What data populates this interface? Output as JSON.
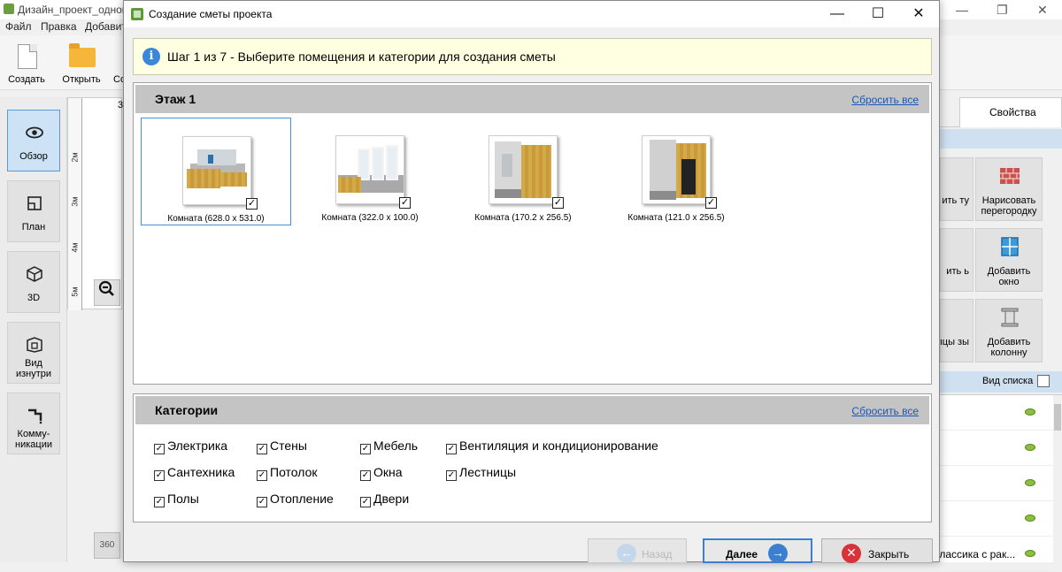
{
  "background_app": {
    "title": "Дизайн_проект_однок",
    "window_controls": [
      "—",
      "❐",
      "✕"
    ],
    "menu": [
      "Файл",
      "Правка",
      "Добавит"
    ],
    "toolbar": [
      {
        "label": "Создать",
        "icon": "new-document-icon"
      },
      {
        "label": "Открыть",
        "icon": "open-folder-icon"
      },
      {
        "label": "Со"
      }
    ],
    "sidebar": [
      {
        "label": "Обзор",
        "icon": "eye-icon",
        "active": true
      },
      {
        "label": "План",
        "icon": "plan-icon"
      },
      {
        "label": "3D",
        "icon": "cube-3d-icon"
      },
      {
        "label": "Вид изнутри",
        "icon": "interior-view-icon"
      },
      {
        "label": "Комму-никации",
        "icon": "pipes-icon"
      }
    ],
    "ruler": {
      "top": "3",
      "labels": [
        "2м",
        "3м",
        "4м",
        "5м"
      ]
    },
    "zoom_icon": "zoom-out-icon",
    "btn360": "360",
    "right_panel": {
      "tab": "Свойства",
      "buttons": [
        {
          "label": "Нарисовать перегородку",
          "icon": "brick-wall-icon"
        },
        {
          "label": "Добавить окно",
          "icon": "window-icon"
        },
        {
          "label": "Добавить колонну",
          "icon": "column-icon"
        }
      ],
      "partial_buttons": [
        "ить ту",
        "ить ь",
        "ицы зы"
      ],
      "list_view": "Вид списка",
      "list_items": [
        "",
        "",
        "",
        "",
        "классика с рак..."
      ]
    }
  },
  "dialog": {
    "title": "Создание сметы проекта",
    "controls": {
      "minimize": "—",
      "maximize": "☐",
      "close": "✕"
    },
    "step": {
      "icon": "i",
      "text": "Шаг 1 из 7 - Выберите помещения и категории для создания сметы"
    },
    "floor": {
      "title": "Этаж 1",
      "reset": "Сбросить все",
      "rooms": [
        {
          "label": "Комната (628.0 х 531.0)",
          "checked": "✓",
          "selected": true
        },
        {
          "label": "Комната (322.0 х 100.0)",
          "checked": "✓"
        },
        {
          "label": "Комната (170.2 х 256.5)",
          "checked": "✓"
        },
        {
          "label": "Комната (121.0 х 256.5)",
          "checked": "✓"
        }
      ]
    },
    "categories": {
      "title": "Категории",
      "reset": "Сбросить все",
      "items": [
        "Электрика",
        "Стены",
        "Мебель",
        "Вентиляция и кондиционирование",
        "Сантехника",
        "Потолок",
        "Окна",
        "Лестницы",
        "Полы",
        "Отопление",
        "Двери"
      ],
      "check_mark": "✓"
    },
    "buttons": {
      "back": "Назад",
      "next": "Далее",
      "close": "Закрыть",
      "back_arrow": "←",
      "next_arrow": "→",
      "close_x": "✕"
    },
    "colors": {
      "accent": "#3c7fd0",
      "link": "#1a56b8",
      "banner": "#ffffe1",
      "close_red": "#d9333a"
    }
  }
}
